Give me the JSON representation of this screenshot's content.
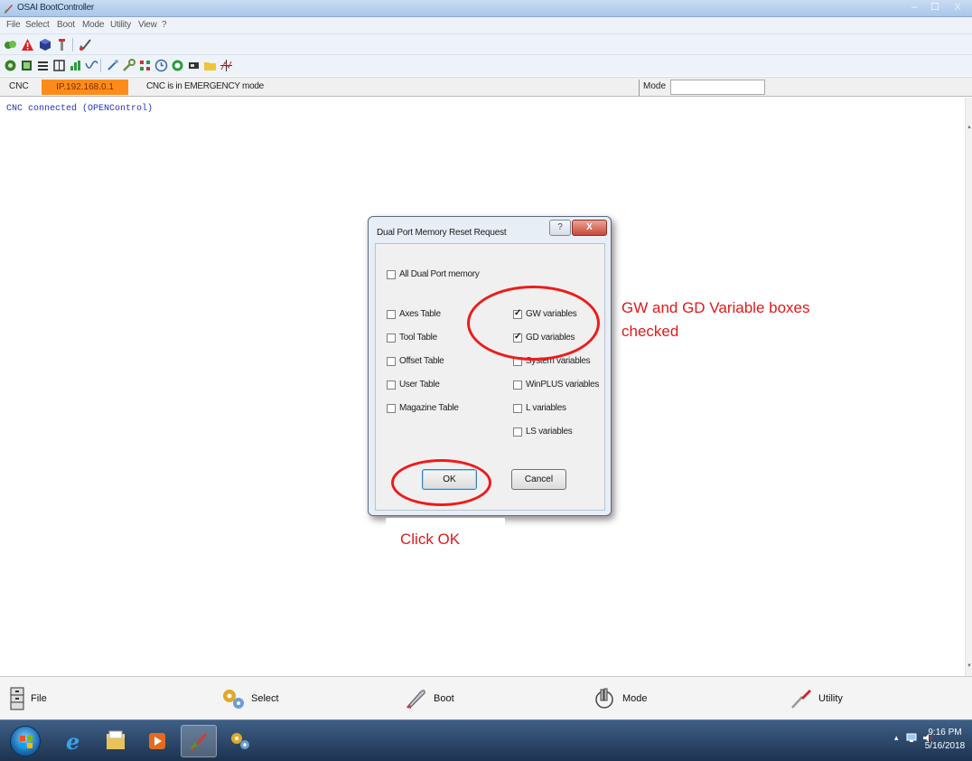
{
  "window": {
    "title": "OSAI BootController",
    "minimize_glyph": "–",
    "maximize_glyph": "☐",
    "close_glyph": "X"
  },
  "menu": [
    "File",
    "Select",
    "Boot",
    "Mode",
    "Utility",
    "View",
    "?"
  ],
  "status": {
    "cnc_label": "CNC",
    "ip": "IP.192.168.0.1",
    "ip_color": "#ff8c1a",
    "message": "CNC is in EMERGENCY mode",
    "mode_label": "Mode",
    "mode_value": ""
  },
  "console": {
    "lines": [
      "CNC connected (OPENControl)"
    ],
    "text_color": "#2233bb"
  },
  "dialog": {
    "title": "Dual Port Memory Reset Request",
    "help_glyph": "?",
    "close_glyph": "X",
    "all_memory": {
      "label": "All Dual Port memory",
      "checked": false
    },
    "left_options": [
      {
        "label": "Axes Table",
        "checked": false
      },
      {
        "label": "Tool Table",
        "checked": false
      },
      {
        "label": "Offset Table",
        "checked": false
      },
      {
        "label": "User Table",
        "checked": false
      },
      {
        "label": "Magazine Table",
        "checked": false
      }
    ],
    "right_options": [
      {
        "label": "GW variables",
        "checked": true
      },
      {
        "label": "GD variables",
        "checked": true
      },
      {
        "label": "System variables",
        "checked": false
      },
      {
        "label": "WinPLUS variables",
        "checked": false
      },
      {
        "label": "L variables",
        "checked": false
      },
      {
        "label": "LS variables",
        "checked": false
      }
    ],
    "ok_label": "OK",
    "cancel_label": "Cancel"
  },
  "annotations": {
    "gw_note": "GW and GD Variable boxes checked",
    "ok_note": "Click OK",
    "color": "#ee1b1b"
  },
  "bottom_buttons": [
    {
      "label": "File",
      "icon": "file-cabinet-icon"
    },
    {
      "label": "Select",
      "icon": "gears-icon"
    },
    {
      "label": "Boot",
      "icon": "rocket-icon"
    },
    {
      "label": "Mode",
      "icon": "hand-icon"
    },
    {
      "label": "Utility",
      "icon": "screwdriver-icon"
    }
  ],
  "taskbar": {
    "time": "9:16 PM",
    "date": "5/16/2018",
    "tray_glyphs": "▴"
  }
}
